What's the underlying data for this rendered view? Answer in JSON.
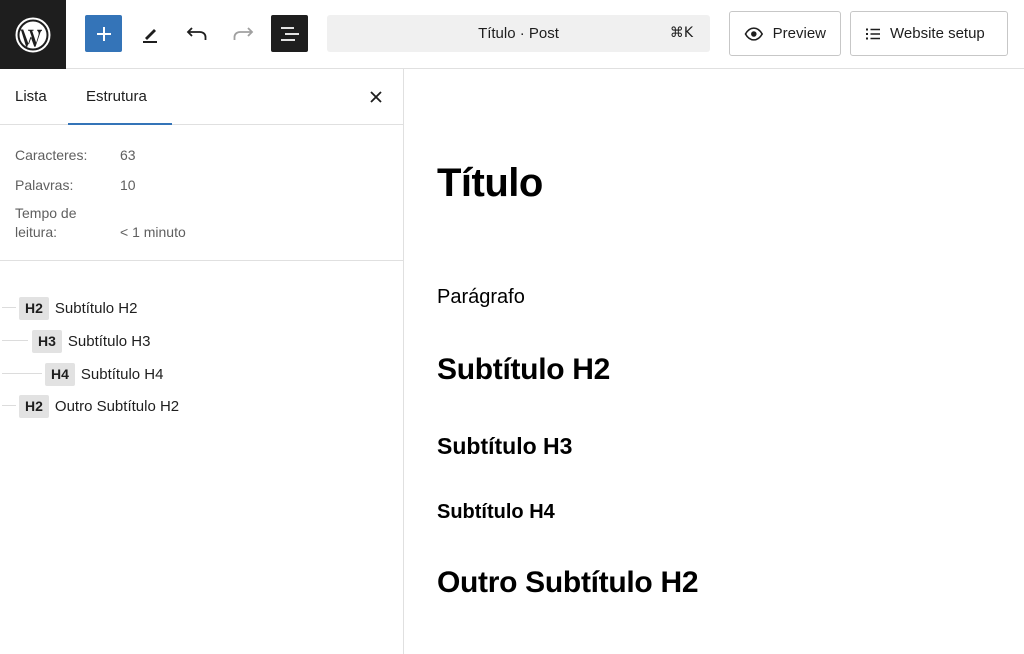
{
  "colors": {
    "accent": "#3474b8",
    "dark": "#1e1e1e",
    "badge_bg": "#e2e2e2",
    "muted_text": "#5f5f5f"
  },
  "toolbar": {
    "logo_icon": "wordpress-logo-icon",
    "add_icon": "plus-icon",
    "tools_icon": "pencil-icon",
    "undo_icon": "undo-icon",
    "redo_icon": "redo-icon",
    "outline_icon": "document-overview-icon",
    "command_bar": {
      "label": "Título · Post",
      "shortcut": "⌘K"
    },
    "preview": {
      "icon": "eye-icon",
      "label": "Preview"
    },
    "website_setup": {
      "icon": "list-icon",
      "label": "Website setup"
    }
  },
  "sidebar": {
    "tabs": [
      {
        "label": "Lista"
      },
      {
        "label": "Estrutura"
      }
    ],
    "active_tab": "Estrutura",
    "close_icon": "close-icon",
    "stats": [
      {
        "label": "Caracteres:",
        "value": "63"
      },
      {
        "label": "Palavras:",
        "value": "10"
      },
      {
        "label": "Tempo de leitura:",
        "value": "< 1 minuto"
      }
    ],
    "outline": [
      {
        "level": "H2",
        "text": "Subtítulo H2"
      },
      {
        "level": "H3",
        "text": "Subtítulo H3"
      },
      {
        "level": "H4",
        "text": "Subtítulo H4"
      },
      {
        "level": "H2",
        "text": "Outro Subtítulo H2"
      }
    ]
  },
  "editor": {
    "title": "Título",
    "paragraph": "Parágrafo",
    "h2": "Subtítulo H2",
    "h3": "Subtítulo H3",
    "h4": "Subtítulo H4",
    "h2_second": "Outro Subtítulo H2"
  }
}
